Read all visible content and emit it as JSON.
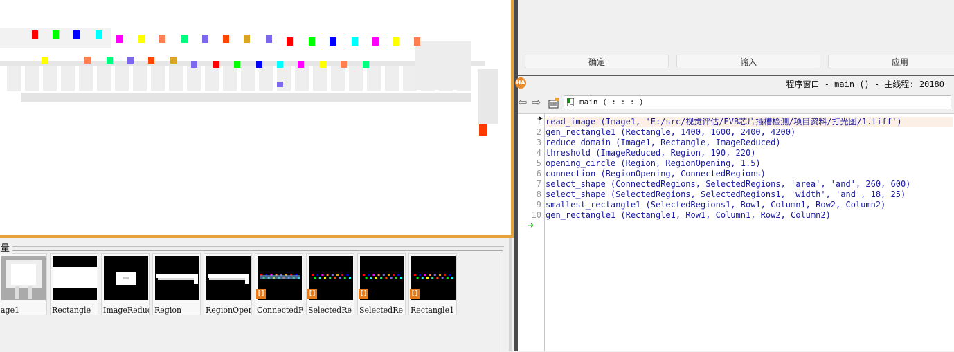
{
  "dialog": {
    "buttons": [
      {
        "label": "确定"
      },
      {
        "label": "输入"
      },
      {
        "label": "应用"
      }
    ]
  },
  "variables": {
    "title": "变量",
    "items": [
      {
        "name": "Image1",
        "label": "age1",
        "tuple": false
      },
      {
        "name": "Rectangle",
        "label": "Rectangle",
        "tuple": false
      },
      {
        "name": "ImageReduced",
        "label": "ImageReduc",
        "tuple": false
      },
      {
        "name": "Region",
        "label": "Region",
        "tuple": false
      },
      {
        "name": "RegionOpening",
        "label": "RegionOper",
        "tuple": false
      },
      {
        "name": "ConnectedRegions",
        "label": "ConnectedF",
        "tuple": true
      },
      {
        "name": "SelectedRegions",
        "label": "SelectedRe",
        "tuple": true
      },
      {
        "name": "SelectedRegions1",
        "label": "SelectedRe",
        "tuple": true
      },
      {
        "name": "Rectangle1",
        "label": "Rectangle1",
        "tuple": true
      }
    ],
    "tuple_badge": "[]"
  },
  "program": {
    "logo": "HA",
    "title": "程序窗口 - main () - 主线程: 20180",
    "procedure": "main ( : : : )",
    "lines": [
      "read_image (Image1, 'E:/src/视觉评估/EVB芯片插槽检测/项目资料/打光图/1.tiff')",
      "gen_rectangle1 (Rectangle, 1400, 1600, 2400, 4200)",
      "reduce_domain (Image1, Rectangle, ImageReduced)",
      "threshold (ImageReduced, Region, 190, 220)",
      "opening_circle (Region, RegionOpening, 1.5)",
      "connection (RegionOpening, ConnectedRegions)",
      "select_shape (ConnectedRegions, SelectedRegions, 'area', 'and', 260, 600)",
      "select_shape (SelectedRegions, SelectedRegions1, 'width', 'and', 18, 25)",
      "smallest_rectangle1 (SelectedRegions1, Row1, Column1, Row2, Column2)",
      "gen_rectangle1 (Rectangle1, Row1, Column1, Row2, Column2)"
    ],
    "line_numbers": [
      "1",
      "2",
      "3",
      "4",
      "5",
      "6",
      "7",
      "8",
      "9",
      "10"
    ],
    "pc_arrow": "➜",
    "nav_back": "⇦",
    "nav_forward": "⇨"
  },
  "colors": {
    "window_border": "#e8a23a",
    "code_text": "#1a1aa0",
    "current_line": "#fcefe6",
    "pc_arrow": "#1aa81a"
  },
  "graphics": {
    "region_colors": [
      "#ff0000",
      "#00ff00",
      "#0000ff",
      "#00ffff",
      "#ff00ff",
      "#ffff00",
      "#ff7f50",
      "#00ff7f",
      "#7b68ee",
      "#ff4500",
      "#daa520",
      "#7b68ee"
    ]
  }
}
